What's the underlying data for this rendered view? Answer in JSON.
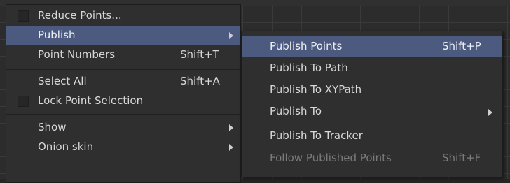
{
  "menu": {
    "partial_top_label": "...",
    "items": [
      {
        "label": "Reduce Points...",
        "shortcut": "",
        "checkbox": true
      },
      {
        "label": "Publish",
        "shortcut": "",
        "submenu": true,
        "highlighted": true
      },
      {
        "label": "Point Numbers",
        "shortcut": "Shift+T"
      },
      {
        "label": "Select All",
        "shortcut": "Shift+A"
      },
      {
        "label": "Lock Point Selection",
        "shortcut": "",
        "checkbox": true
      },
      {
        "label": "Show",
        "shortcut": "",
        "submenu": true
      },
      {
        "label": "Onion skin",
        "shortcut": "",
        "submenu": true
      }
    ]
  },
  "submenu": {
    "items": [
      {
        "label": "Publish Points",
        "shortcut": "Shift+P",
        "highlighted": true
      },
      {
        "label": "Publish To Path",
        "shortcut": ""
      },
      {
        "label": "Publish To XYPath",
        "shortcut": ""
      },
      {
        "label": "Publish To",
        "shortcut": "",
        "submenu": true
      },
      {
        "label": "Publish To Tracker",
        "shortcut": ""
      },
      {
        "label": "Follow Published Points",
        "shortcut": "Shift+F",
        "disabled": true
      }
    ]
  },
  "colors": {
    "highlight": "#4d5a80",
    "menu_bg": "#2f2f2f",
    "disabled_text": "#7c7c7c"
  }
}
